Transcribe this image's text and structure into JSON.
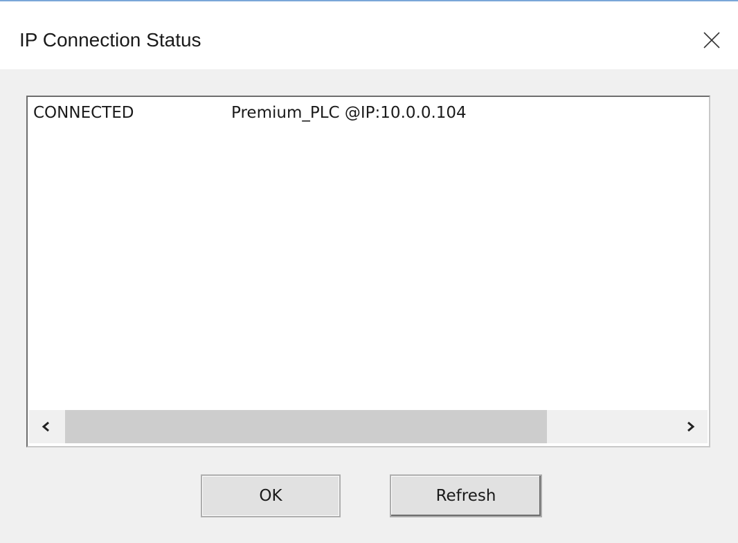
{
  "window": {
    "title": "IP Connection Status"
  },
  "icons": {
    "close": "close-icon",
    "scroll_left": "chevron-left-icon",
    "scroll_right": "chevron-right-icon"
  },
  "connection_list": {
    "rows": [
      {
        "status": "CONNECTED",
        "device": "Premium_PLC @IP:10.0.0.104"
      }
    ]
  },
  "buttons": {
    "ok_label": "OK",
    "refresh_label": "Refresh"
  },
  "colors": {
    "titlebar": "#ffffff",
    "dialog_background": "#f0f0f0",
    "scroll_thumb": "#cdcdcd",
    "button_face": "#e1e1e1"
  }
}
